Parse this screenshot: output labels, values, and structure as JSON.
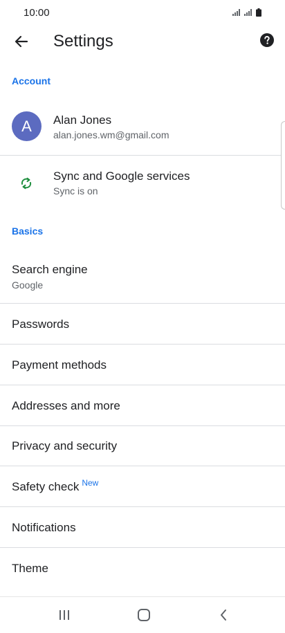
{
  "status_bar": {
    "time": "10:00"
  },
  "app_bar": {
    "title": "Settings"
  },
  "sections": {
    "account": "Account",
    "basics": "Basics"
  },
  "account": {
    "avatar_letter": "A",
    "name": "Alan Jones",
    "email": "alan.jones.wm@gmail.com"
  },
  "sync": {
    "title": "Sync and Google services",
    "subtitle": "Sync is on"
  },
  "search_engine": {
    "title": "Search engine",
    "value": "Google"
  },
  "items": {
    "passwords": "Passwords",
    "payment_methods": "Payment methods",
    "addresses": "Addresses and more",
    "privacy": "Privacy and security",
    "safety_check": "Safety check",
    "safety_check_badge": "New",
    "notifications": "Notifications",
    "theme": "Theme"
  },
  "colors": {
    "accent": "#1a73e8",
    "avatar": "#5c6bc0",
    "sync_icon": "#1e8e3e"
  },
  "icons": {
    "back": "arrow-back-icon",
    "help": "help-icon",
    "sync": "sync-icon",
    "recents": "recents-icon",
    "home": "home-icon",
    "nav_back": "nav-back-icon"
  }
}
